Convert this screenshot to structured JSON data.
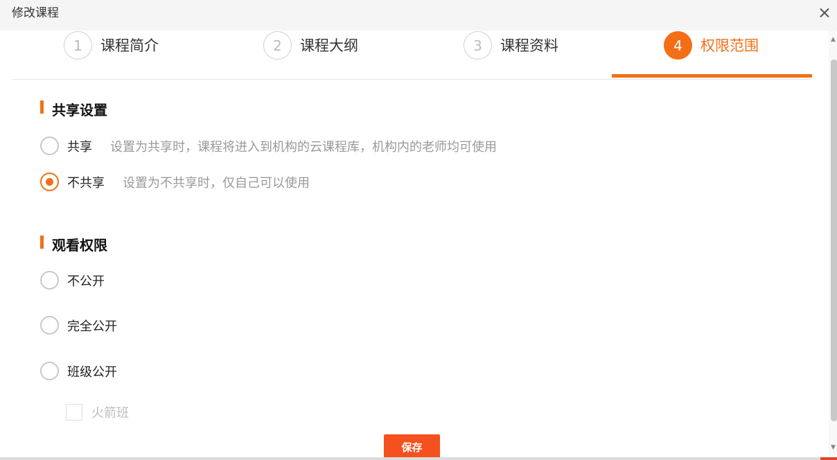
{
  "window": {
    "title": "修改课程",
    "close_icon": "close-icon"
  },
  "steps": [
    {
      "number": "1",
      "label": "课程简介"
    },
    {
      "number": "2",
      "label": "课程大纲"
    },
    {
      "number": "3",
      "label": "课程资料"
    },
    {
      "number": "4",
      "label": "权限范围",
      "active": true
    }
  ],
  "share_settings": {
    "title": "共享设置",
    "options": [
      {
        "label": "共享",
        "description": "设置为共享时，课程将进入到机构的云课程库，机构内的老师均可使用",
        "checked": false
      },
      {
        "label": "不共享",
        "description": "设置为不共享时，仅自己可以使用",
        "checked": true
      }
    ]
  },
  "view_permission": {
    "title": "观看权限",
    "options": [
      {
        "label": "不公开",
        "checked": false
      },
      {
        "label": "完全公开",
        "checked": false
      },
      {
        "label": "班级公开",
        "checked": false
      }
    ],
    "classes": [
      {
        "label": "火箭班",
        "checked": false,
        "disabled": true
      }
    ]
  },
  "actions": {
    "save_label": "保存"
  },
  "colors": {
    "accent": "#f36f16",
    "save_button": "#f4511e",
    "muted_text": "#999999"
  }
}
